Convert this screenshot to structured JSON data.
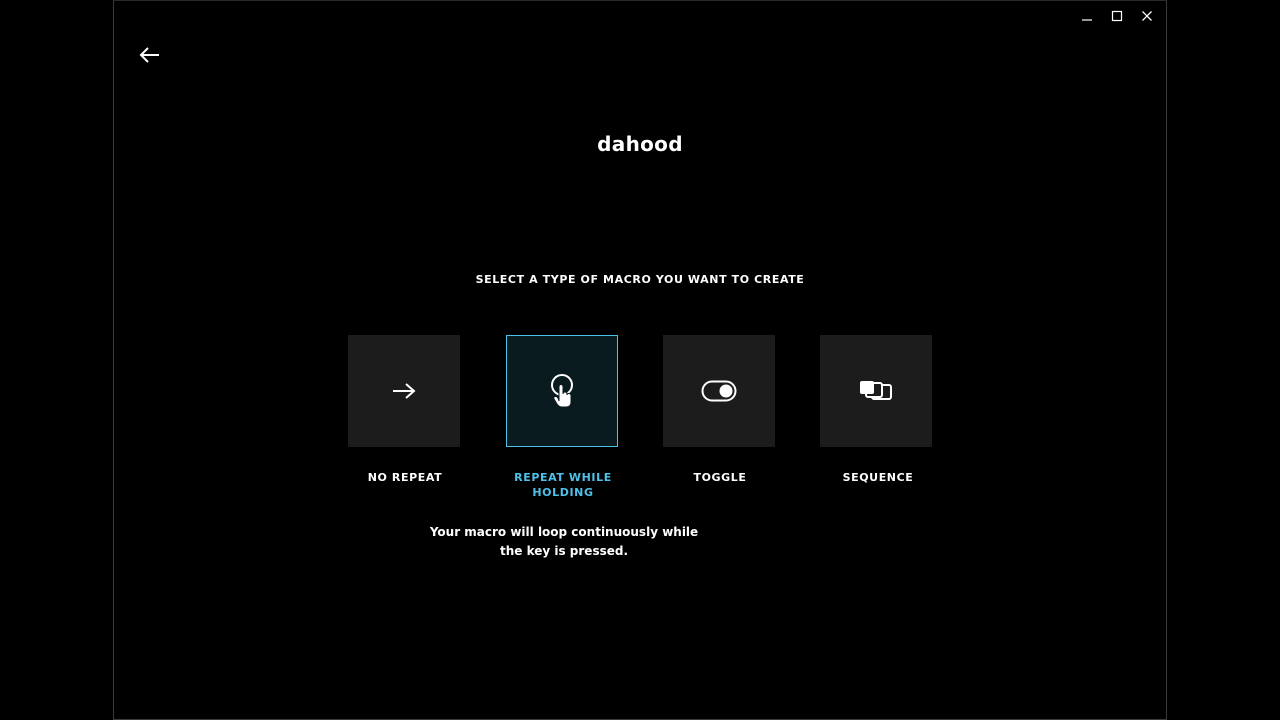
{
  "window": {
    "controls": {
      "minimize_icon": "minimize-icon",
      "maximize_icon": "maximize-icon",
      "close_icon": "close-icon"
    }
  },
  "page": {
    "title": "dahood",
    "subtitle": "SELECT A TYPE OF MACRO YOU WANT TO CREATE",
    "description": "Your macro will loop continuously while the key is pressed."
  },
  "macro_types": [
    {
      "label": "NO REPEAT",
      "icon": "arrow-right-icon",
      "selected": false
    },
    {
      "label": "REPEAT WHILE HOLDING",
      "icon": "hold-press-icon",
      "selected": true
    },
    {
      "label": "TOGGLE",
      "icon": "toggle-switch-icon",
      "selected": false
    },
    {
      "label": "SEQUENCE",
      "icon": "sequence-icon",
      "selected": false
    }
  ],
  "colors": {
    "accent": "#4fc1e9",
    "card_bg": "#1c1c1c",
    "selected_bg": "#0a1b20",
    "background": "#000000"
  }
}
